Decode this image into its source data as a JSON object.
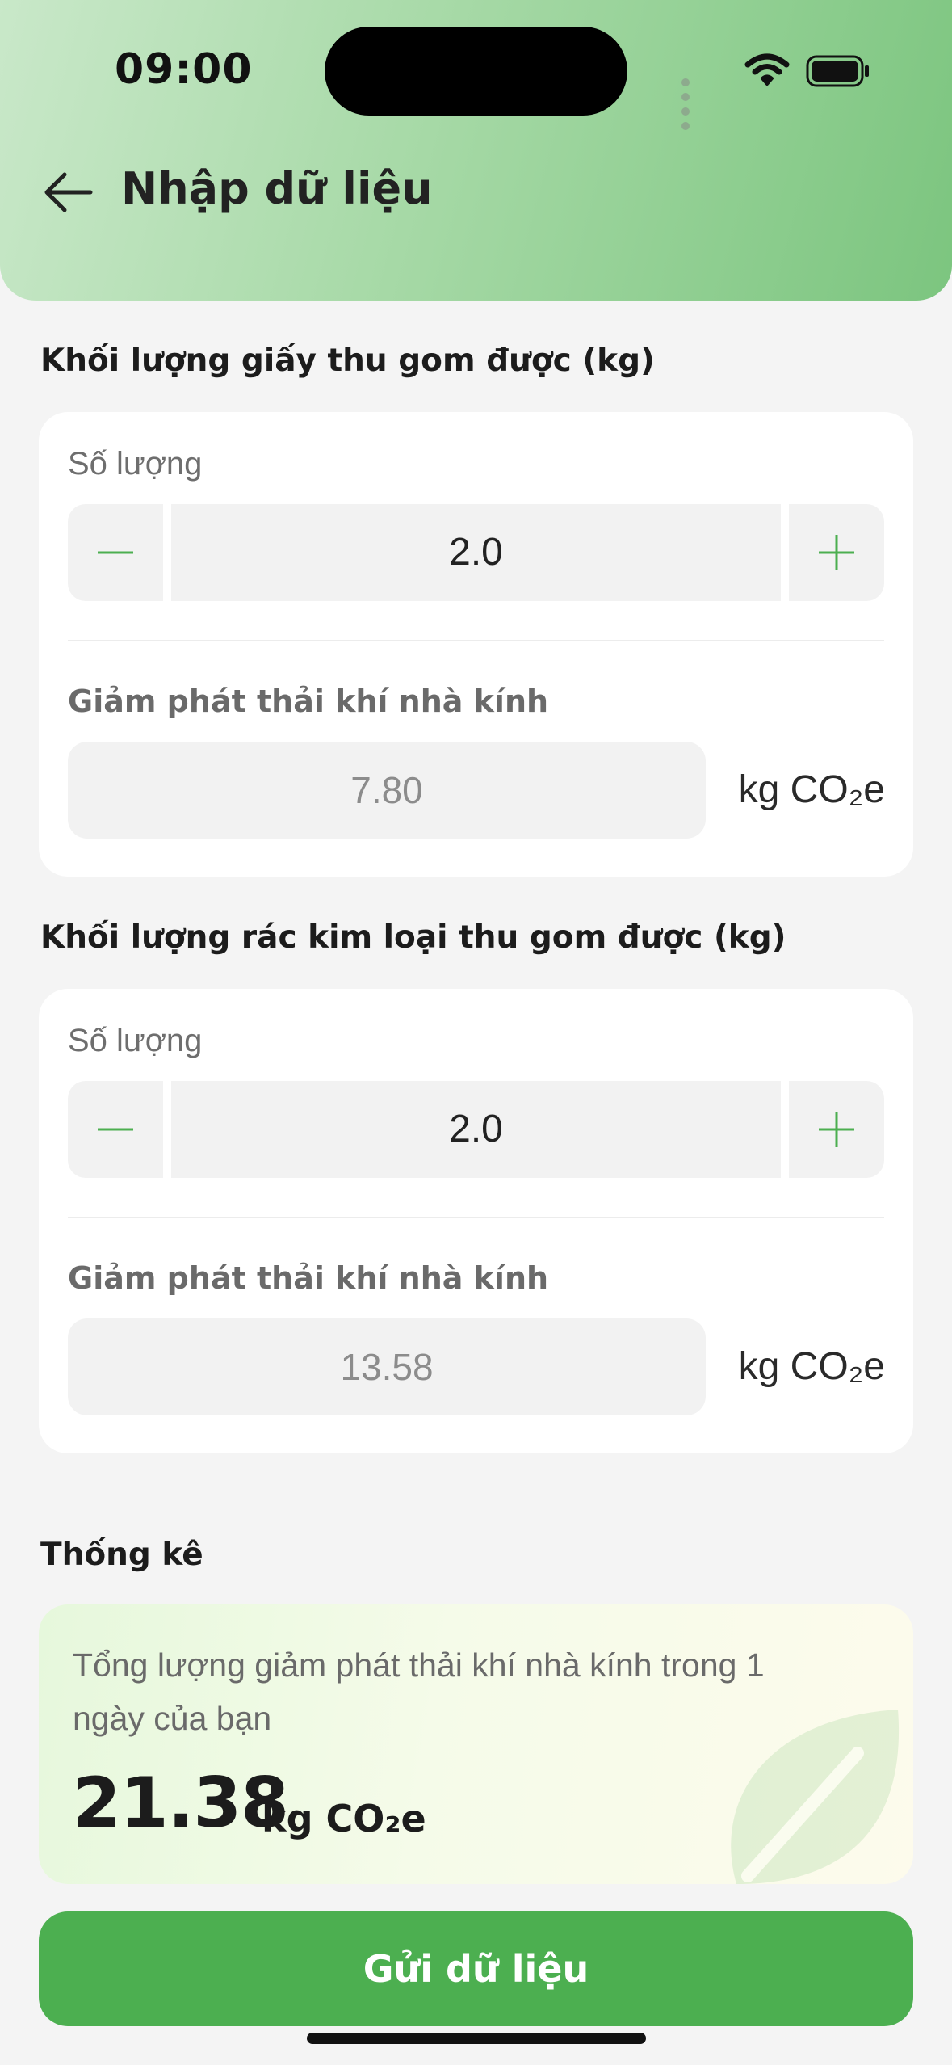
{
  "status_bar": {
    "time": "09:00"
  },
  "header": {
    "title": "Nhập dữ liệu"
  },
  "sections": [
    {
      "title": "Khối lượng giấy thu gom được (kg)",
      "quantity_label": "Số lượng",
      "quantity_value": "2.0",
      "reduction_label": "Giảm phát thải khí nhà kính",
      "reduction_value": "7.80",
      "reduction_unit": "kg CO₂e"
    },
    {
      "title": "Khối lượng rác kim loại thu gom được (kg)",
      "quantity_label": "Số lượng",
      "quantity_value": "2.0",
      "reduction_label": "Giảm phát thải khí nhà kính",
      "reduction_value": "13.58",
      "reduction_unit": "kg CO₂e"
    }
  ],
  "stats": {
    "title": "Thống kê",
    "description": "Tổng lượng giảm phát thải khí nhà kính trong 1 ngày của bạn",
    "total_value": "21.38",
    "total_unit": "kg CO₂e"
  },
  "submit_label": "Gửi dữ liệu",
  "colors": {
    "accent": "#4caf50",
    "header_gradient_start": "#c9e8c9",
    "header_gradient_end": "#7cc57f"
  },
  "icons": [
    "back-arrow-icon",
    "minus-icon",
    "plus-icon",
    "wifi-icon",
    "battery-icon",
    "leaf-icon"
  ]
}
